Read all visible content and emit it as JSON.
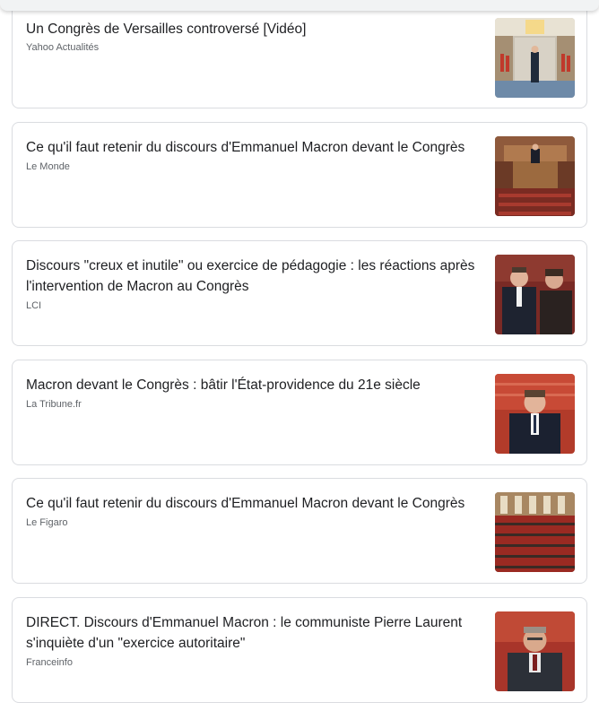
{
  "articles": [
    {
      "title": "Un Congrès de Versailles controversé [Vidéo]",
      "source": "Yahoo Actualités",
      "thumbnail": "versailles-hall-photo"
    },
    {
      "title": "Ce qu'il faut retenir du discours d'Emmanuel Macron devant le Congrès",
      "source": "Le Monde",
      "thumbnail": "congress-tribune-photo"
    },
    {
      "title": "Discours \"creux et inutile\" ou exercice de pédagogie : les réactions après l'intervention de Macron au Congrès",
      "source": "LCI",
      "thumbnail": "macron-with-official-photo"
    },
    {
      "title": "Macron devant le Congrès : bâtir l'État-providence du 21e siècle",
      "source": "La Tribune.fr",
      "thumbnail": "macron-speaking-photo"
    },
    {
      "title": "Ce qu'il faut retenir du discours d'Emmanuel Macron devant le Congrès",
      "source": "Le Figaro",
      "thumbnail": "congress-hemicycle-photo"
    },
    {
      "title": "DIRECT. Discours d'Emmanuel Macron : le communiste Pierre Laurent s'inquiète d'un \"exercice autoritaire\"",
      "source": "Franceinfo",
      "thumbnail": "pierre-laurent-photo"
    }
  ]
}
